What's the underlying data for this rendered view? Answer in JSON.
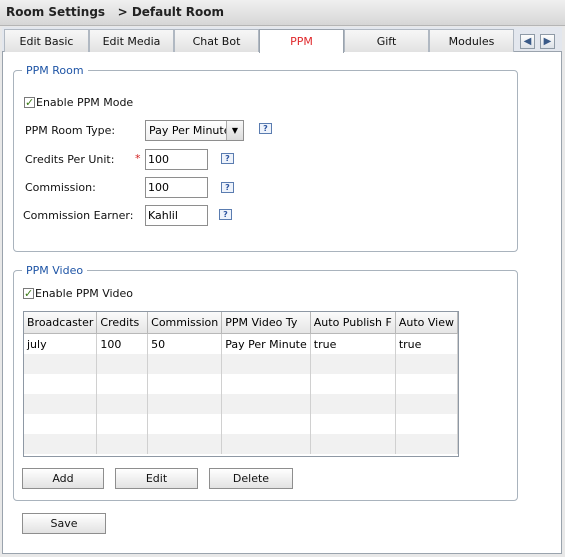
{
  "title": "Room Settings   > Default Room",
  "tabs": [
    {
      "label": "Edit Basic"
    },
    {
      "label": "Edit Media"
    },
    {
      "label": "Chat Bot"
    },
    {
      "label": "PPM"
    },
    {
      "label": "Gift"
    },
    {
      "label": "Modules"
    }
  ],
  "nav": {
    "prev_icon": "arrow-left-icon",
    "next_icon": "arrow-right-icon",
    "prev_glyph": "◀",
    "next_glyph": "▶"
  },
  "ppm_room": {
    "legend": "PPM Room",
    "enable_label": "Enable PPM Mode",
    "enabled": true,
    "room_type_label": "PPM Room Type:",
    "room_type_value": "Pay Per Minute",
    "credits_label": "Credits Per Unit:",
    "credits_value": "100",
    "required_mark": "*",
    "commission_label": "Commission:",
    "commission_value": "100",
    "earner_label": "Commission Earner:",
    "earner_value": "Kahlil",
    "help_glyph": "?"
  },
  "ppm_video": {
    "legend": "PPM Video",
    "enable_label": "Enable PPM Video",
    "enabled": true,
    "columns": [
      "Broadcaster",
      "Credits",
      "Commission",
      "PPM Video Ty",
      "Auto Publish F",
      "Auto View"
    ],
    "rows": [
      [
        "july",
        "100",
        "50",
        "Pay Per Minute",
        "true",
        "true"
      ]
    ],
    "add_label": "Add",
    "edit_label": "Edit",
    "delete_label": "Delete"
  },
  "save_label": "Save",
  "colors": {
    "active_tab": "#e0282b",
    "legend": "#1f55a6",
    "check": "#3b7a15"
  }
}
